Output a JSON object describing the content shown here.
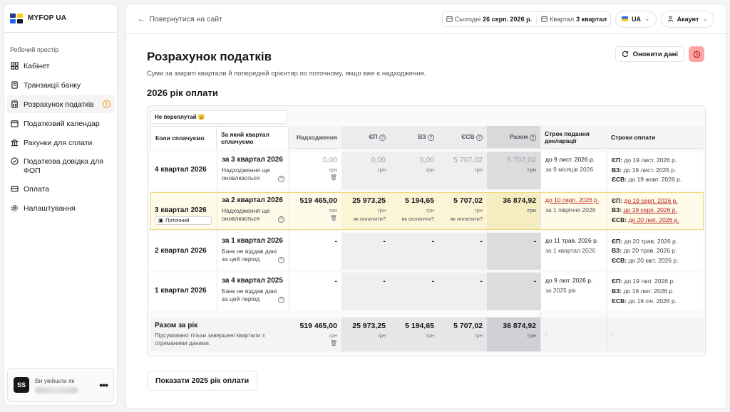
{
  "brand": {
    "name": "MYFOP UA",
    "colors": [
      "#1e3a8a",
      "#facc15",
      "#2563eb",
      "#111827"
    ]
  },
  "sidebar": {
    "section_label": "Робочий простір",
    "items": [
      {
        "label": "Кабінет",
        "icon": "dashboard-icon"
      },
      {
        "label": "Транзакції банку",
        "icon": "document-icon"
      },
      {
        "label": "Розрахунок податків",
        "icon": "calculator-icon",
        "active": true,
        "warning": "!"
      },
      {
        "label": "Податковий календар",
        "icon": "calendar-icon"
      },
      {
        "label": "Рахунки для сплати",
        "icon": "bank-icon"
      },
      {
        "label": "Податкова довідка для ФОП",
        "icon": "check-circle-icon"
      },
      {
        "label": "Оплата",
        "icon": "card-icon"
      },
      {
        "label": "Налаштування",
        "icon": "gear-icon"
      }
    ],
    "user": {
      "label": "Ви увійшли як",
      "initials": "SS",
      "menu": "•••"
    }
  },
  "topbar": {
    "back_label": "Повернутися на сайт",
    "today_label": "Сьогодні",
    "today_value": "26 серп. 2026 р.",
    "quarter_label": "Квартал",
    "quarter_value": "3 квартал",
    "lang": "UA",
    "account": "Акаунт"
  },
  "page": {
    "title": "Розрахунок податків",
    "subtitle": "Суми за закриті квартали й попередній орієнтир по поточному, якщо вже є надходження.",
    "refresh_label": "Оновити дані",
    "year_title": "2026 рік оплати",
    "note": "Не переплутай 😉",
    "show_more": "Показати 2025 рік оплати"
  },
  "table": {
    "headers": {
      "when": "Коли сплачуємо",
      "for": "За який квартал сплачуємо",
      "income": "Надходження",
      "ep": "ЄП",
      "vz": "ВЗ",
      "esv": "ЄСВ",
      "total": "Разом",
      "deadline": "Строк подання декларації",
      "pay": "Строки оплати"
    },
    "currency": "грн",
    "how": "як оплатити?",
    "current_badge": "Поточний",
    "rows": [
      {
        "when": "4 квартал 2026",
        "for": "за 3 квартал 2026",
        "for_sub": "Надходження ще оновлюються",
        "income": "0,00",
        "ep": "0,00",
        "vz": "0,00",
        "esv": "5 707,02",
        "total": "5 707,02",
        "deadline": "до 9 лист. 2026 р.",
        "deadline_sub": "за 9 місяців 2026",
        "pay_ep": "до 19 лист. 2026 р.",
        "pay_vz": "до 19 лист. 2026 р.",
        "pay_esv": "до 19 жовт. 2026 р."
      },
      {
        "when": "3 квартал 2026",
        "for": "за 2 квартал 2026",
        "for_sub": "Надходження ще оновлюються",
        "income": "519 465,00",
        "ep": "25 973,25",
        "vz": "5 194,65",
        "esv": "5 707,02",
        "total": "36 874,92",
        "deadline": "до 10 серп. 2026 р.",
        "deadline_sub": "за 1 півріччя 2026",
        "pay_ep": "до 19 серп. 2026 р.",
        "pay_vz": "до 19 серп. 2026 р.",
        "pay_esv": "до 20 лип. 2026 р."
      },
      {
        "when": "2 квартал 2026",
        "for": "за 1 квартал 2026",
        "for_sub": "Банк не віддав дані за цей період",
        "income": "-",
        "ep": "-",
        "vz": "-",
        "esv": "-",
        "total": "-",
        "deadline": "до 11 трав. 2026 р.",
        "deadline_sub": "за 1 квартал 2026",
        "pay_ep": "до 20 трав. 2026 р.",
        "pay_vz": "до 20 трав. 2026 р.",
        "pay_esv": "до 20 квіт. 2026 р."
      },
      {
        "when": "1 квартал 2026",
        "for": "за 4 квартал 2025",
        "for_sub": "Банк не віддав дані за цей період",
        "income": "-",
        "ep": "-",
        "vz": "-",
        "esv": "-",
        "total": "-",
        "deadline": "до 9 лют. 2026 р.",
        "deadline_sub": "за 2025 рік",
        "pay_ep": "до 19 лют. 2026 р.",
        "pay_vz": "до 19 лют. 2026 р.",
        "pay_esv": "до 19 січ. 2026 р."
      }
    ],
    "pay_labels": {
      "ep": "ЄП:",
      "vz": "ВЗ:",
      "esv": "ЄСВ:"
    },
    "summary": {
      "label": "Разом за рік",
      "sub": "Підсумовано тільки завершені квартали з отриманими даними.",
      "income": "519 465,00",
      "ep": "25 973,25",
      "vz": "5 194,65",
      "esv": "5 707,02",
      "total": "36 874,92",
      "deadline": "-",
      "pay": "-"
    }
  }
}
